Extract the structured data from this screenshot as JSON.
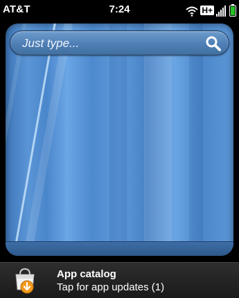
{
  "status_bar": {
    "carrier": "AT&T",
    "time": "7:24",
    "network_type": "H+",
    "icons": [
      "wifi-icon",
      "signal-icon",
      "battery-icon"
    ],
    "battery_color": "#22c322"
  },
  "search": {
    "placeholder": "Just type...",
    "icon": "search-icon"
  },
  "wallpaper": {
    "accent": "#5a95d6"
  },
  "notification": {
    "icon": "app-catalog-icon",
    "title": "App catalog",
    "subtitle": "Tap for app updates (1)"
  }
}
